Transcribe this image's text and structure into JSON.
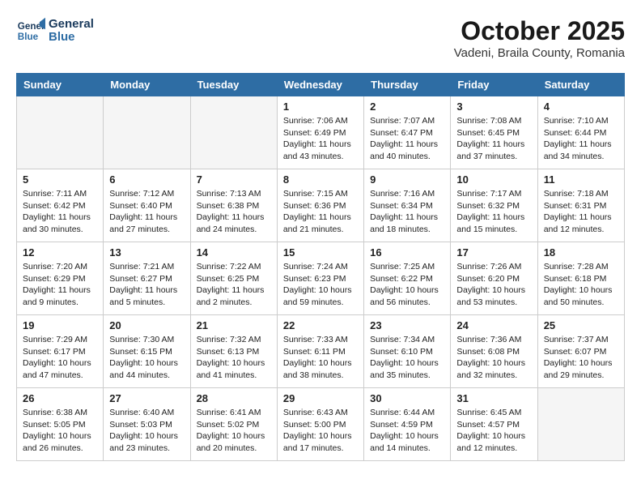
{
  "header": {
    "logo_line1": "General",
    "logo_line2": "Blue",
    "month_title": "October 2025",
    "subtitle": "Vadeni, Braila County, Romania"
  },
  "columns": [
    "Sunday",
    "Monday",
    "Tuesday",
    "Wednesday",
    "Thursday",
    "Friday",
    "Saturday"
  ],
  "weeks": [
    [
      {
        "day": "",
        "info": ""
      },
      {
        "day": "",
        "info": ""
      },
      {
        "day": "",
        "info": ""
      },
      {
        "day": "1",
        "info": "Sunrise: 7:06 AM\nSunset: 6:49 PM\nDaylight: 11 hours\nand 43 minutes."
      },
      {
        "day": "2",
        "info": "Sunrise: 7:07 AM\nSunset: 6:47 PM\nDaylight: 11 hours\nand 40 minutes."
      },
      {
        "day": "3",
        "info": "Sunrise: 7:08 AM\nSunset: 6:45 PM\nDaylight: 11 hours\nand 37 minutes."
      },
      {
        "day": "4",
        "info": "Sunrise: 7:10 AM\nSunset: 6:44 PM\nDaylight: 11 hours\nand 34 minutes."
      }
    ],
    [
      {
        "day": "5",
        "info": "Sunrise: 7:11 AM\nSunset: 6:42 PM\nDaylight: 11 hours\nand 30 minutes."
      },
      {
        "day": "6",
        "info": "Sunrise: 7:12 AM\nSunset: 6:40 PM\nDaylight: 11 hours\nand 27 minutes."
      },
      {
        "day": "7",
        "info": "Sunrise: 7:13 AM\nSunset: 6:38 PM\nDaylight: 11 hours\nand 24 minutes."
      },
      {
        "day": "8",
        "info": "Sunrise: 7:15 AM\nSunset: 6:36 PM\nDaylight: 11 hours\nand 21 minutes."
      },
      {
        "day": "9",
        "info": "Sunrise: 7:16 AM\nSunset: 6:34 PM\nDaylight: 11 hours\nand 18 minutes."
      },
      {
        "day": "10",
        "info": "Sunrise: 7:17 AM\nSunset: 6:32 PM\nDaylight: 11 hours\nand 15 minutes."
      },
      {
        "day": "11",
        "info": "Sunrise: 7:18 AM\nSunset: 6:31 PM\nDaylight: 11 hours\nand 12 minutes."
      }
    ],
    [
      {
        "day": "12",
        "info": "Sunrise: 7:20 AM\nSunset: 6:29 PM\nDaylight: 11 hours\nand 9 minutes."
      },
      {
        "day": "13",
        "info": "Sunrise: 7:21 AM\nSunset: 6:27 PM\nDaylight: 11 hours\nand 5 minutes."
      },
      {
        "day": "14",
        "info": "Sunrise: 7:22 AM\nSunset: 6:25 PM\nDaylight: 11 hours\nand 2 minutes."
      },
      {
        "day": "15",
        "info": "Sunrise: 7:24 AM\nSunset: 6:23 PM\nDaylight: 10 hours\nand 59 minutes."
      },
      {
        "day": "16",
        "info": "Sunrise: 7:25 AM\nSunset: 6:22 PM\nDaylight: 10 hours\nand 56 minutes."
      },
      {
        "day": "17",
        "info": "Sunrise: 7:26 AM\nSunset: 6:20 PM\nDaylight: 10 hours\nand 53 minutes."
      },
      {
        "day": "18",
        "info": "Sunrise: 7:28 AM\nSunset: 6:18 PM\nDaylight: 10 hours\nand 50 minutes."
      }
    ],
    [
      {
        "day": "19",
        "info": "Sunrise: 7:29 AM\nSunset: 6:17 PM\nDaylight: 10 hours\nand 47 minutes."
      },
      {
        "day": "20",
        "info": "Sunrise: 7:30 AM\nSunset: 6:15 PM\nDaylight: 10 hours\nand 44 minutes."
      },
      {
        "day": "21",
        "info": "Sunrise: 7:32 AM\nSunset: 6:13 PM\nDaylight: 10 hours\nand 41 minutes."
      },
      {
        "day": "22",
        "info": "Sunrise: 7:33 AM\nSunset: 6:11 PM\nDaylight: 10 hours\nand 38 minutes."
      },
      {
        "day": "23",
        "info": "Sunrise: 7:34 AM\nSunset: 6:10 PM\nDaylight: 10 hours\nand 35 minutes."
      },
      {
        "day": "24",
        "info": "Sunrise: 7:36 AM\nSunset: 6:08 PM\nDaylight: 10 hours\nand 32 minutes."
      },
      {
        "day": "25",
        "info": "Sunrise: 7:37 AM\nSunset: 6:07 PM\nDaylight: 10 hours\nand 29 minutes."
      }
    ],
    [
      {
        "day": "26",
        "info": "Sunrise: 6:38 AM\nSunset: 5:05 PM\nDaylight: 10 hours\nand 26 minutes."
      },
      {
        "day": "27",
        "info": "Sunrise: 6:40 AM\nSunset: 5:03 PM\nDaylight: 10 hours\nand 23 minutes."
      },
      {
        "day": "28",
        "info": "Sunrise: 6:41 AM\nSunset: 5:02 PM\nDaylight: 10 hours\nand 20 minutes."
      },
      {
        "day": "29",
        "info": "Sunrise: 6:43 AM\nSunset: 5:00 PM\nDaylight: 10 hours\nand 17 minutes."
      },
      {
        "day": "30",
        "info": "Sunrise: 6:44 AM\nSunset: 4:59 PM\nDaylight: 10 hours\nand 14 minutes."
      },
      {
        "day": "31",
        "info": "Sunrise: 6:45 AM\nSunset: 4:57 PM\nDaylight: 10 hours\nand 12 minutes."
      },
      {
        "day": "",
        "info": ""
      }
    ]
  ]
}
